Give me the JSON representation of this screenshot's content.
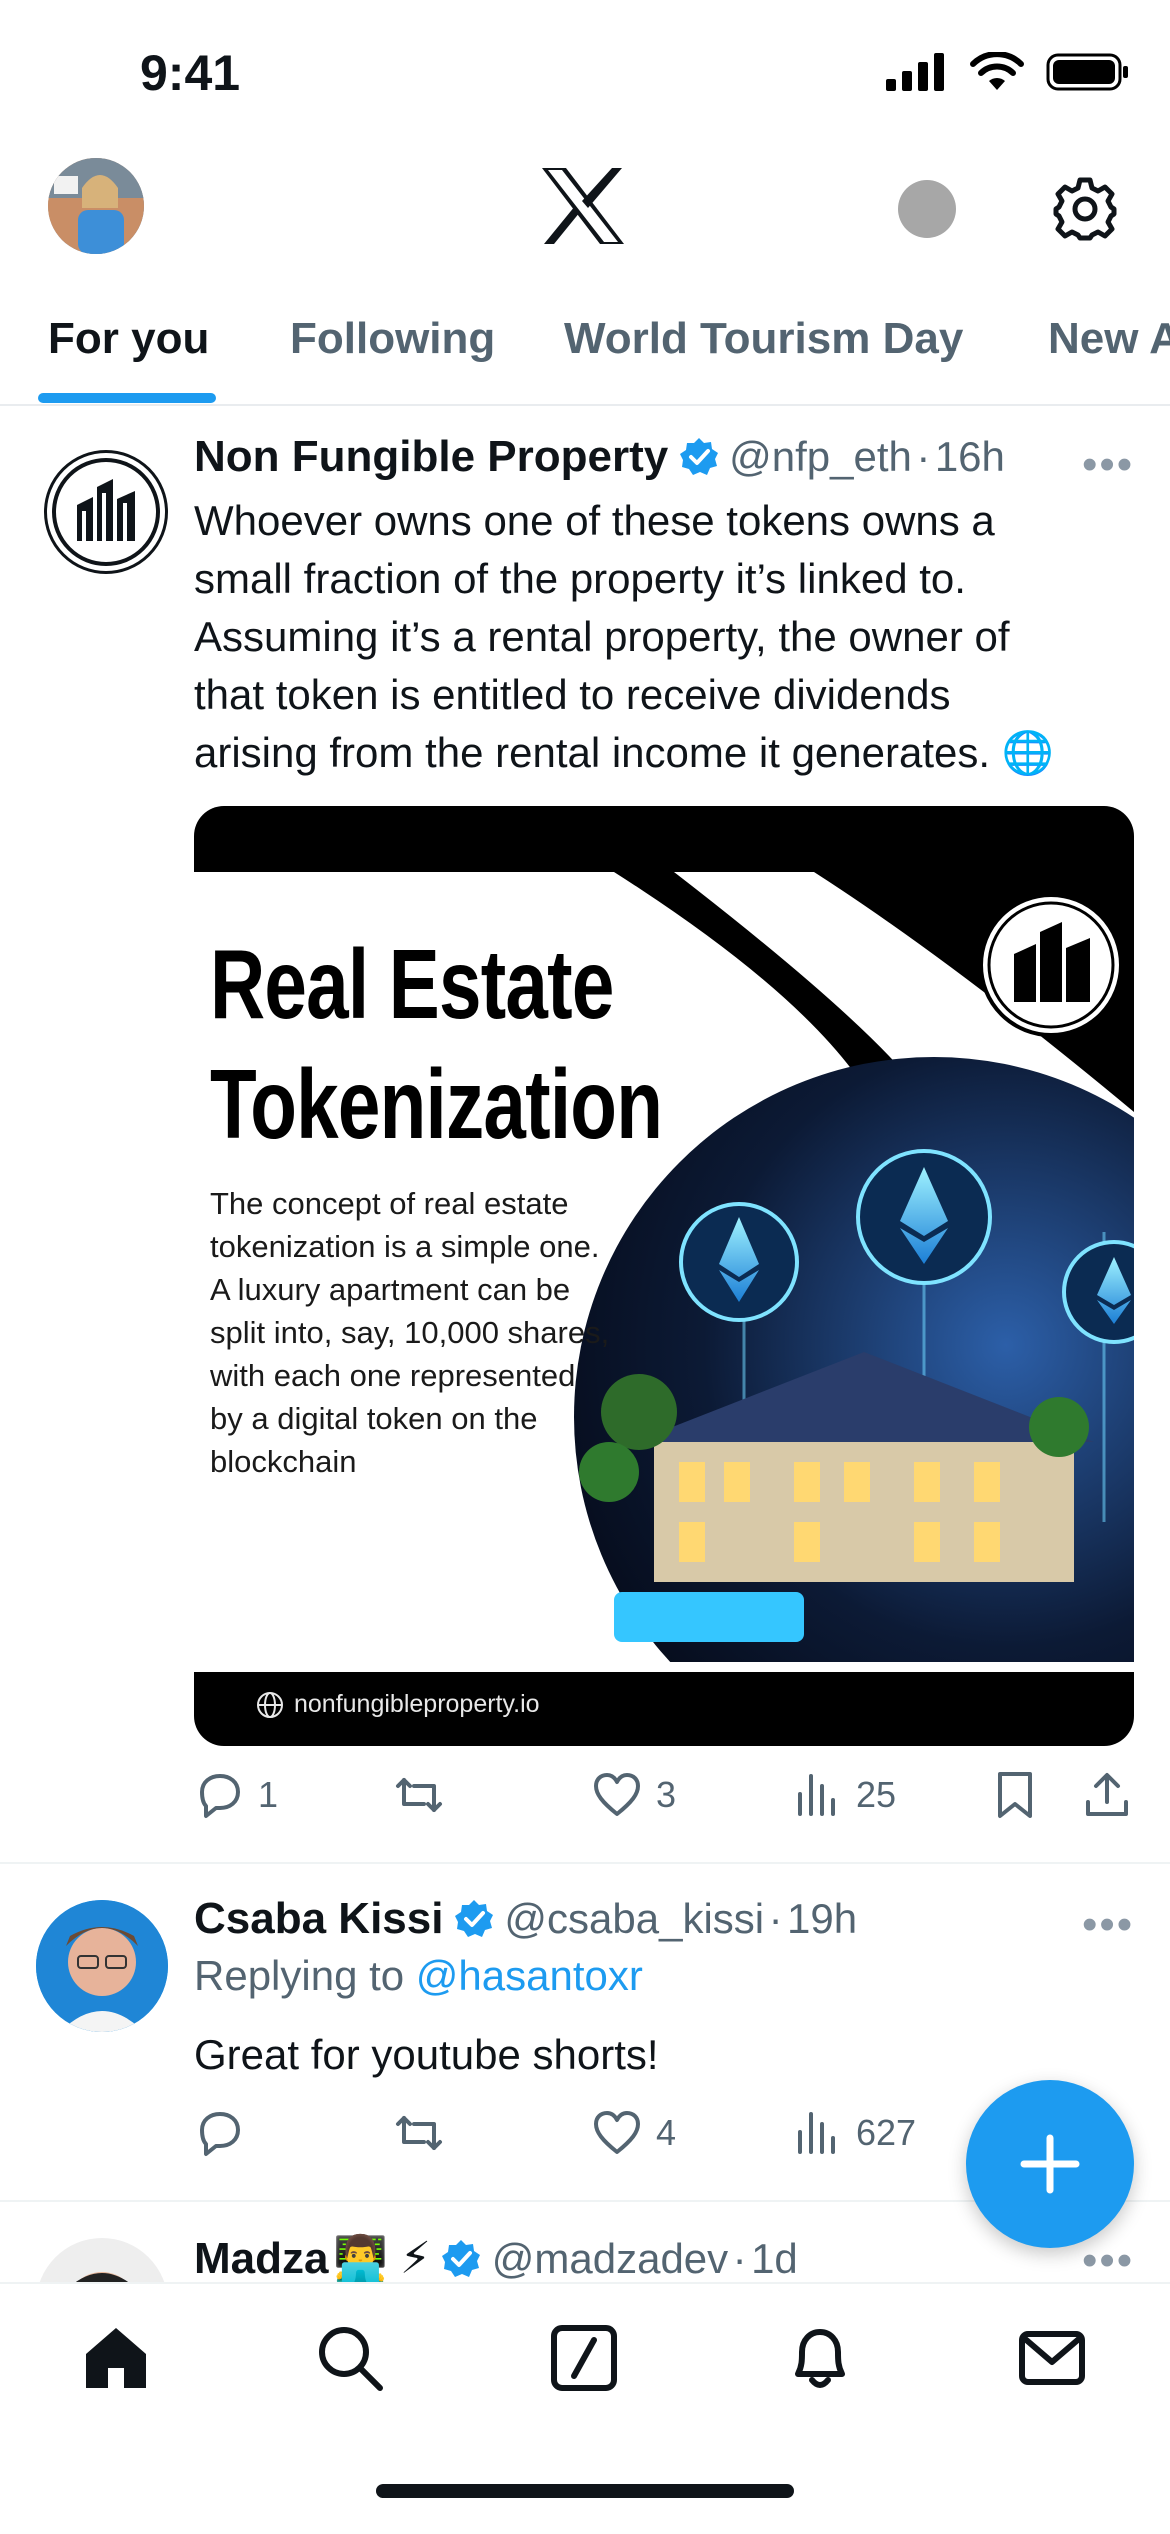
{
  "status_bar": {
    "time": "9:41"
  },
  "header": {
    "logo": "X"
  },
  "tabs": [
    {
      "label": "For you",
      "active": true
    },
    {
      "label": "Following",
      "active": false
    },
    {
      "label": "World Tourism Day",
      "active": false
    },
    {
      "label": "New A",
      "active": false
    }
  ],
  "tweets": [
    {
      "name": "Non Fungible Property",
      "handle": "@nfp_eth",
      "sep": "·",
      "time": "16h",
      "text_lines": [
        "Whoever owns one of these tokens owns a",
        "small fraction of the property it’s linked to.",
        "Assuming it’s a rental property, the owner of",
        "that token is entitled to receive dividends",
        "arising from the rental income it generates."
      ],
      "emoji": "🌐",
      "media": {
        "title_line1": "Real Estate",
        "title_line2": "Tokenization",
        "description": "The concept of real estate tokenization is a simple one. A luxury apartment can be split into, say, 10,000 shares, with each one represented by a digital token on the blockchain",
        "footer": "nonfungibleproperty.io"
      },
      "replies": "1",
      "reposts": "",
      "likes": "3",
      "views": "25"
    },
    {
      "name": "Csaba Kissi",
      "handle": "@csaba_kissi",
      "sep": "·",
      "time": "19h",
      "replying_prefix": "Replying to ",
      "replying_to": "@hasantoxr",
      "text": "Great for youtube shorts!",
      "replies": "",
      "reposts": "",
      "likes": "4",
      "views": "627"
    },
    {
      "name": "Madza",
      "name_emoji": "👨‍💻 ⚡",
      "handle": "@madzadev",
      "sep": "·",
      "time": "1d"
    }
  ],
  "colors": {
    "accent": "#1d9bf0",
    "text": "#0f1419",
    "muted": "#536471"
  },
  "icons": [
    "signal-icon",
    "wifi-icon",
    "battery-icon",
    "x-logo-icon",
    "gear-icon",
    "verified-icon",
    "more-icon",
    "reply-icon",
    "repost-icon",
    "like-icon",
    "views-icon",
    "bookmark-icon",
    "share-icon",
    "plus-icon",
    "home-icon",
    "search-icon",
    "compose-icon",
    "bell-icon",
    "mail-icon"
  ]
}
